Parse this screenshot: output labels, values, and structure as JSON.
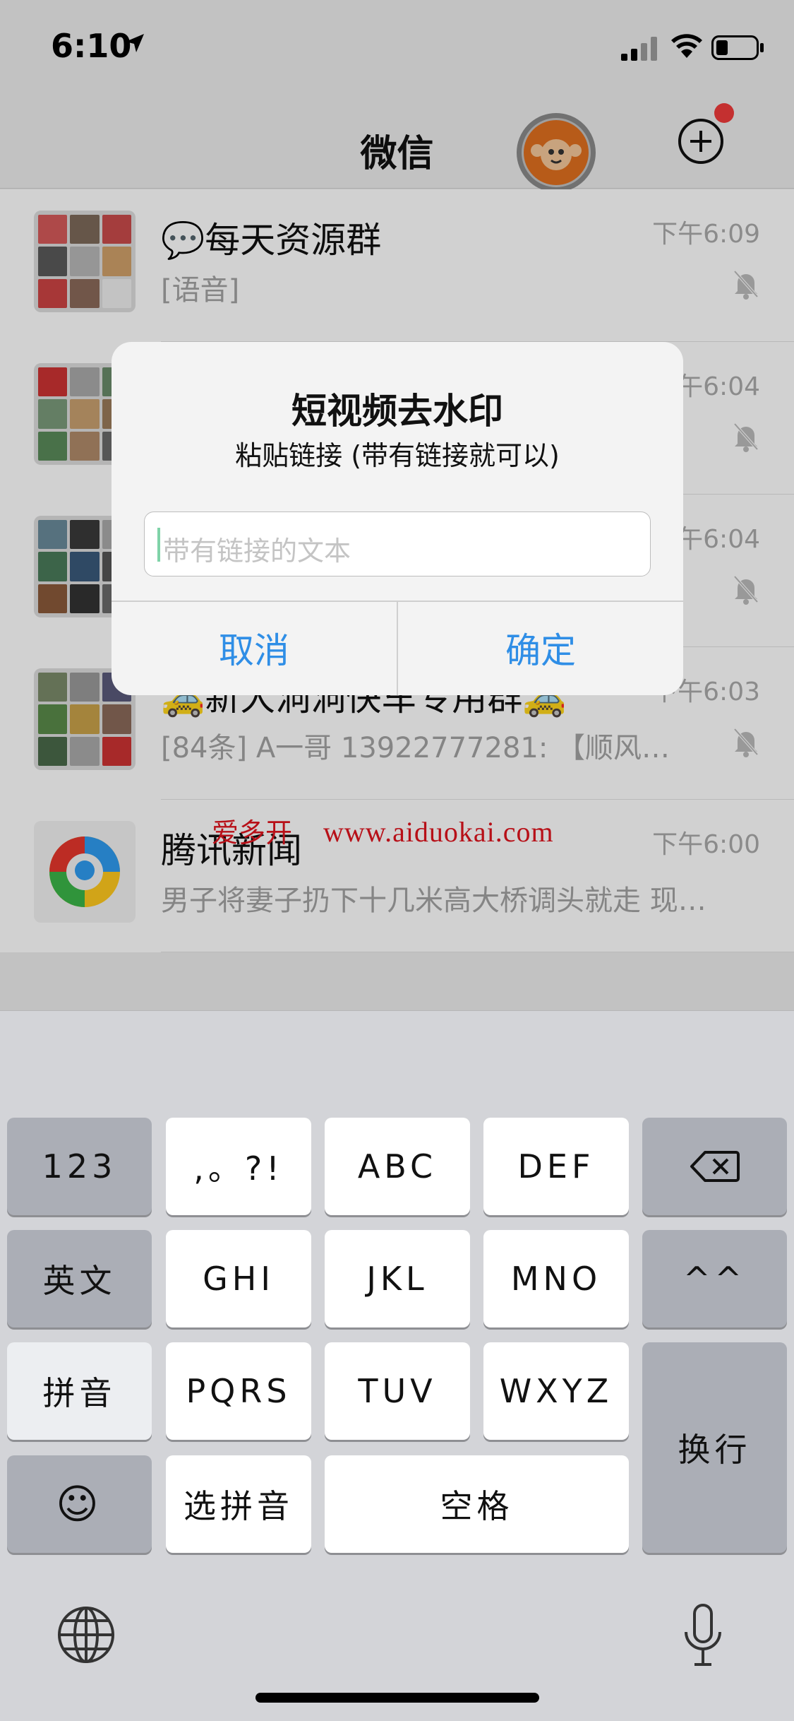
{
  "status_bar": {
    "time": "6:10"
  },
  "nav": {
    "title": "微信"
  },
  "chats": [
    {
      "name": "💬每天资源群",
      "time": "下午6:09",
      "preview": "[语音]",
      "muted": true
    },
    {
      "name": "",
      "time": "下午6:04",
      "preview": "",
      "muted": true
    },
    {
      "name": "",
      "time": "下午6:04",
      "preview": "",
      "muted": true
    },
    {
      "name": "🚕新大洞洞快车专用群🚕",
      "time": "下午6:03",
      "preview": "[84条] A一哥 13922777281: 【顺风…",
      "muted": true
    },
    {
      "name": "腾讯新闻",
      "time": "下午6:00",
      "preview": "男子将妻子扔下十几米高大桥调头就走 现…",
      "muted": false
    }
  ],
  "watermark": {
    "author": "爱多开",
    "site": "www.aiduokai.com"
  },
  "dialog": {
    "title": "短视频去水印",
    "message": "粘贴链接 (带有链接就可以)",
    "input_placeholder": "带有链接的文本",
    "cancel_label": "取消",
    "confirm_label": "确定"
  },
  "keyboard": {
    "row1": [
      "123",
      ",。?!",
      "ABC",
      "DEF"
    ],
    "row2": [
      "英文",
      "GHI",
      "JKL",
      "MNO",
      "^^"
    ],
    "row3": [
      "拼音",
      "PQRS",
      "TUV",
      "WXYZ"
    ],
    "row4": [
      "☺",
      "选拼音",
      "空格"
    ],
    "return_label": "换行"
  },
  "colors": {
    "accent": "#2f8ee6",
    "badge": "#ef3b3b",
    "watermark": "#e0141e"
  }
}
